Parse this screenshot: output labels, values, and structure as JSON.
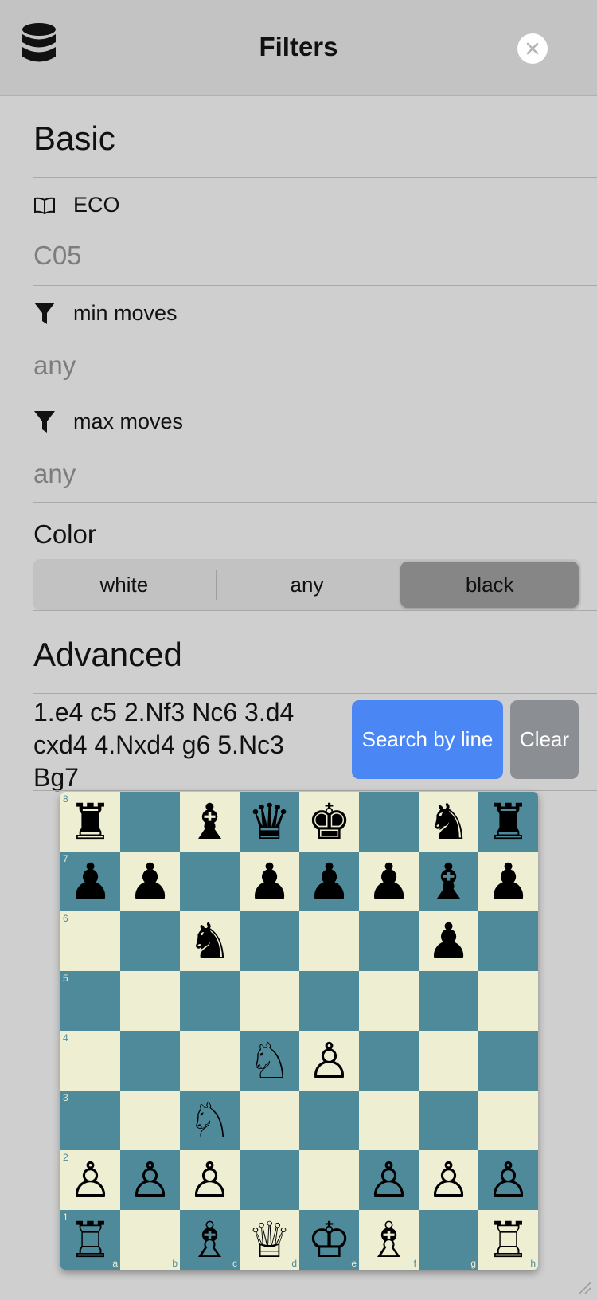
{
  "header": {
    "title": "Filters"
  },
  "basic": {
    "section_title": "Basic",
    "eco": {
      "label": "ECO",
      "value": "C05"
    },
    "min_moves": {
      "label": "min moves",
      "value": "any"
    },
    "max_moves": {
      "label": "max moves",
      "value": "any"
    },
    "color": {
      "label": "Color",
      "options": [
        "white",
        "any",
        "black"
      ],
      "selected": "black"
    }
  },
  "advanced": {
    "section_title": "Advanced",
    "line": "1.e4 c5 2.Nf3 Nc6 3.d4 cxd4 4.Nxd4 g6 5.Nc3 Bg7",
    "search_button": "Search by line",
    "clear_button": "Clear"
  },
  "board": {
    "files": [
      "a",
      "b",
      "c",
      "d",
      "e",
      "f",
      "g",
      "h"
    ],
    "ranks": [
      "8",
      "7",
      "6",
      "5",
      "4",
      "3",
      "2",
      "1"
    ],
    "rows": [
      "r.bqk.nr",
      "pp.ppppbp",
      "..n...p.",
      "........",
      "...NP...",
      "..N.....",
      "PPP..PPP",
      "R.BQKB.R"
    ]
  },
  "icons": {
    "database": "database-icon",
    "close": "close-icon",
    "book": "book-icon",
    "filter": "filter-icon",
    "resize": "resize-grip-icon"
  },
  "colors": {
    "accent": "#4a86f4",
    "board_light": "#eeeed2",
    "board_dark": "#4f8a9a"
  }
}
